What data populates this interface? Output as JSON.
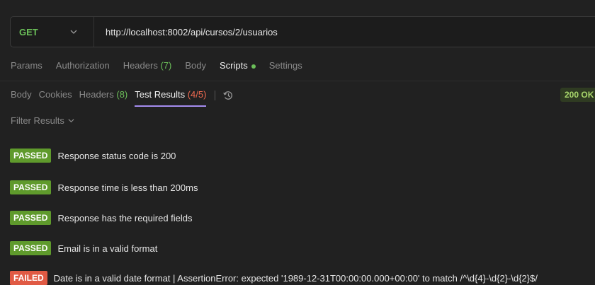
{
  "request": {
    "method": "GET",
    "url": "http://localhost:8002/api/cursos/2/usuarios"
  },
  "request_tabs": [
    {
      "label": "Params"
    },
    {
      "label": "Authorization"
    },
    {
      "label": "Headers",
      "count": "(7)"
    },
    {
      "label": "Body"
    },
    {
      "label": "Scripts",
      "active": true
    }
  ],
  "settings_label": "Settings",
  "response_tabs": {
    "body": "Body",
    "cookies": "Cookies",
    "headers": "Headers",
    "headers_count": "(8)",
    "test_results": "Test Results",
    "test_results_count": "(4/5)"
  },
  "status": "200 OK",
  "filter_label": "Filter Results",
  "results": [
    {
      "status": "PASSED",
      "text": "Response status code is 200"
    },
    {
      "status": "PASSED",
      "text": "Response time is less than 200ms"
    },
    {
      "status": "PASSED",
      "text": "Response has the required fields"
    },
    {
      "status": "PASSED",
      "text": "Email is in a valid format"
    },
    {
      "status": "FAILED",
      "text": "Date is in a valid date format | AssertionError: expected '1989-12-31T00:00:00.000+00:00' to match /^\\d{4}-\\d{2}-\\d{2}$/"
    }
  ],
  "colors": {
    "pass": "#5f9a2c",
    "fail": "#e05a44",
    "accent": "#a58cf0",
    "method": "#6bbf59"
  }
}
